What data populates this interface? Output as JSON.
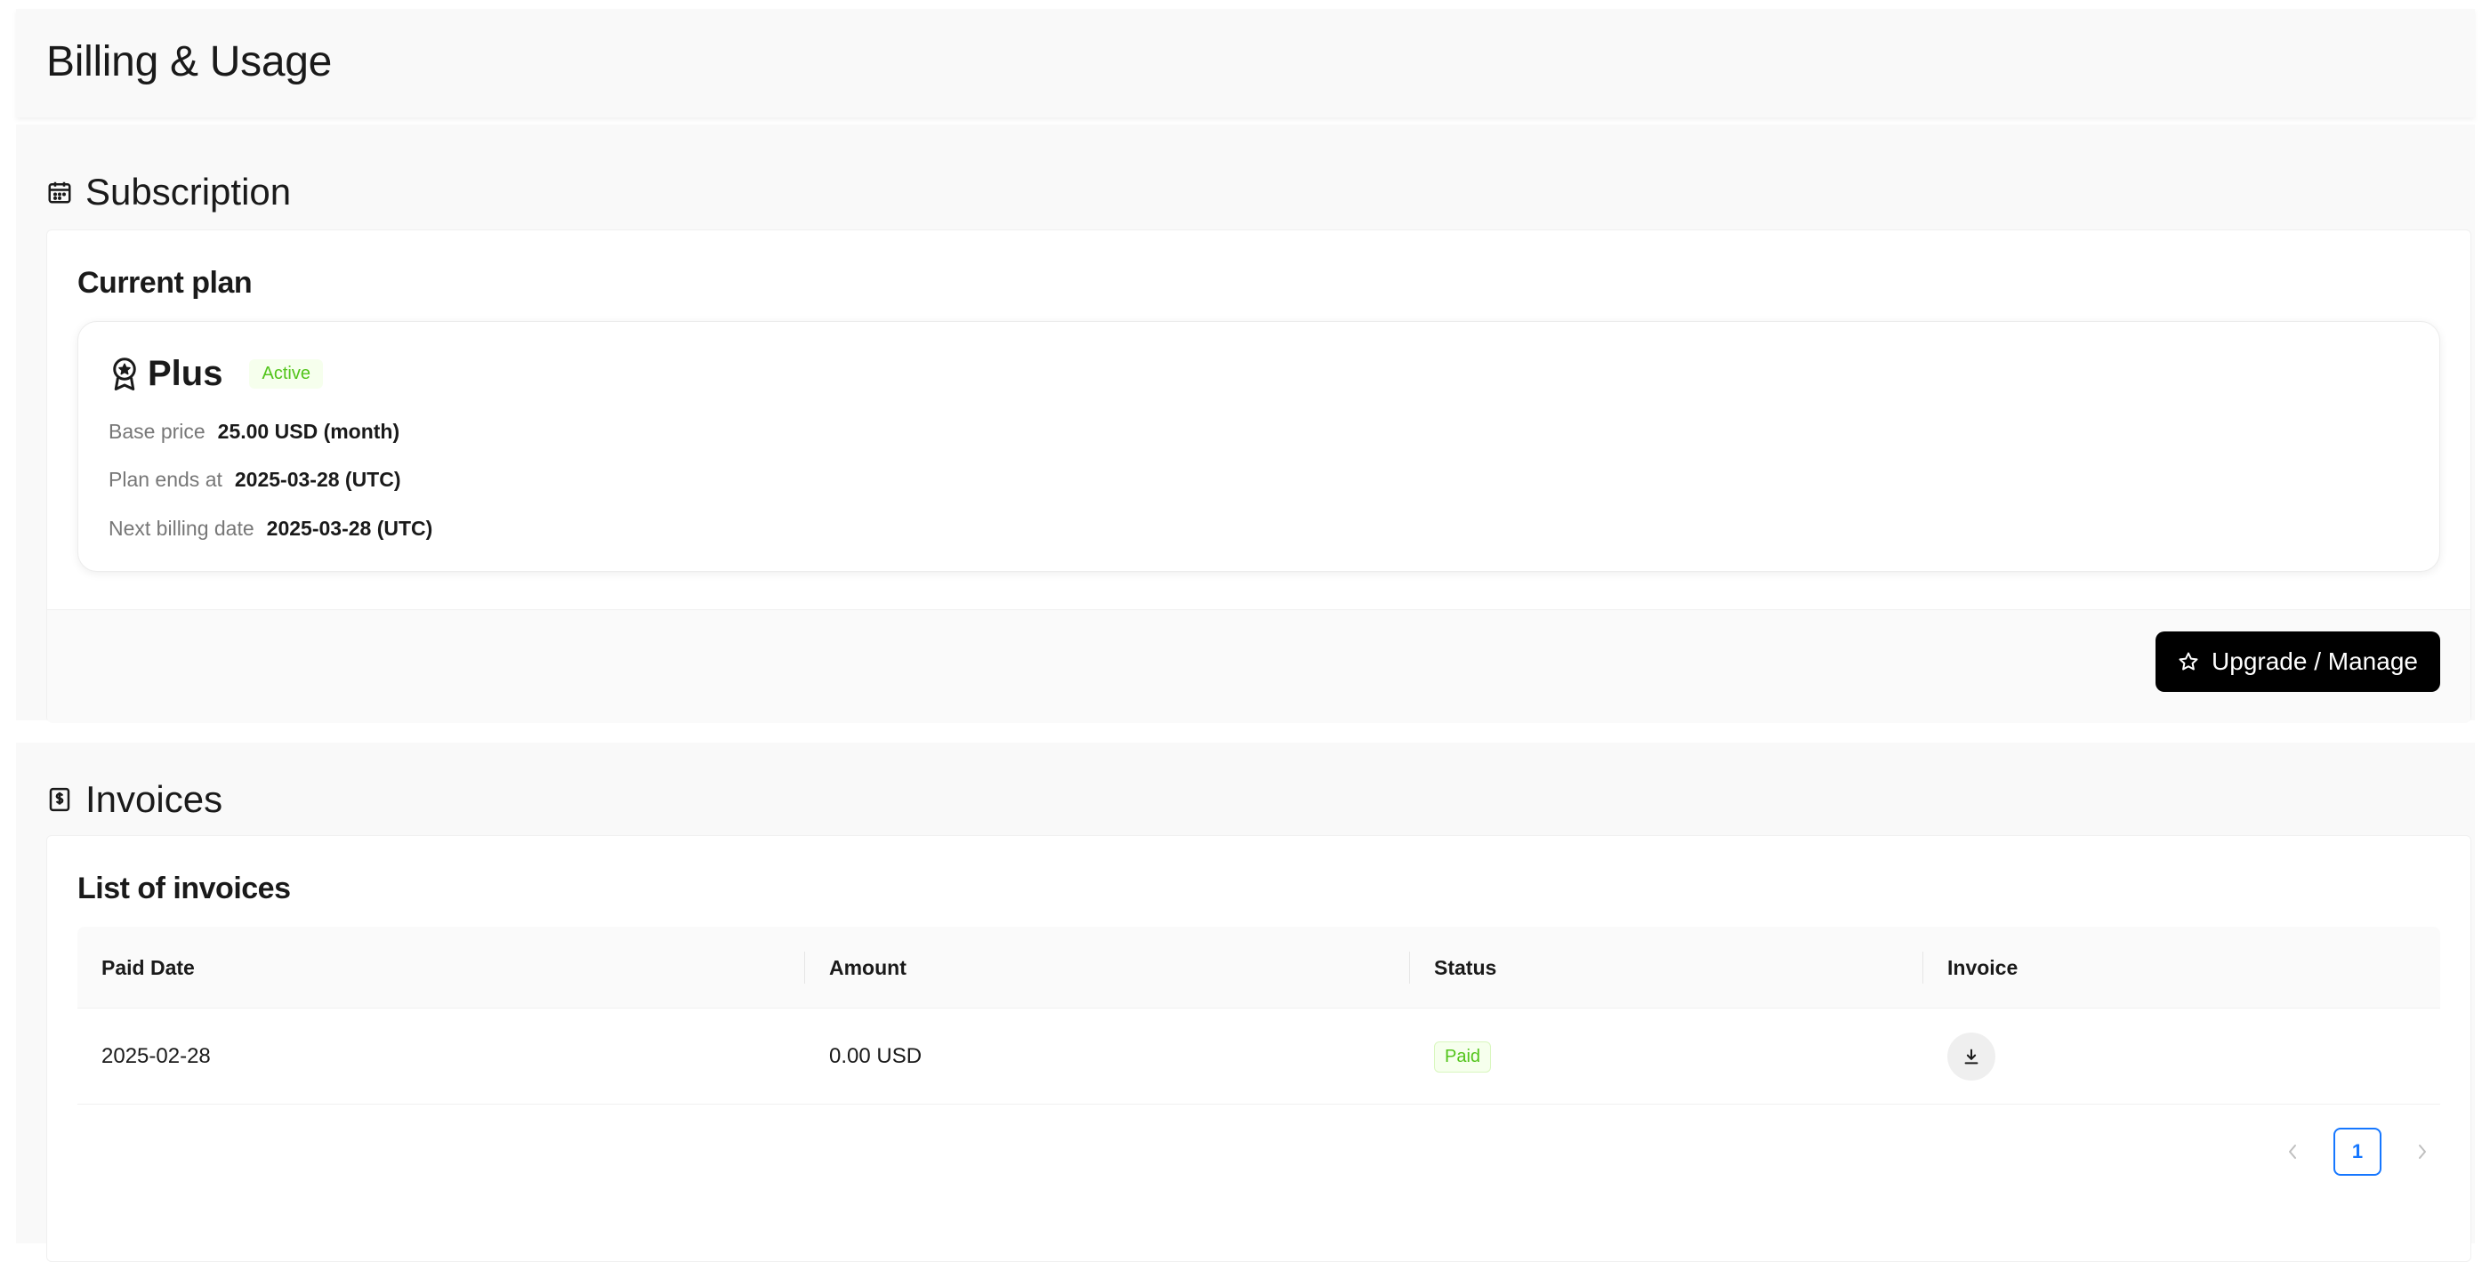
{
  "page": {
    "title": "Billing & Usage"
  },
  "subscription": {
    "section_title": "Subscription",
    "section_icon": "calendar-icon",
    "card_title": "Current plan",
    "plan": {
      "icon": "award-icon",
      "name": "Plus",
      "status": "Active",
      "status_color": "#52c41a",
      "rows": [
        {
          "label": "Base price",
          "value": "25.00 USD (month)"
        },
        {
          "label": "Plan ends at",
          "value": "2025-03-28 (UTC)"
        },
        {
          "label": "Next billing date",
          "value": "2025-03-28 (UTC)"
        }
      ]
    },
    "button": {
      "label": "Upgrade / Manage",
      "icon": "star-icon"
    }
  },
  "invoices": {
    "section_title": "Invoices",
    "section_icon": "receipt-icon",
    "card_title": "List of invoices",
    "columns": [
      "Paid Date",
      "Amount",
      "Status",
      "Invoice"
    ],
    "rows": [
      {
        "paid_date": "2025-02-28",
        "amount": "0.00 USD",
        "status": "Paid",
        "invoice_icon": "download-icon"
      }
    ],
    "pagination": {
      "current_page": "1",
      "prev_icon": "chevron-left-icon",
      "next_icon": "chevron-right-icon"
    }
  },
  "colors": {
    "accent": "#1677ff",
    "success": "#52c41a",
    "button_bg": "#000000"
  }
}
